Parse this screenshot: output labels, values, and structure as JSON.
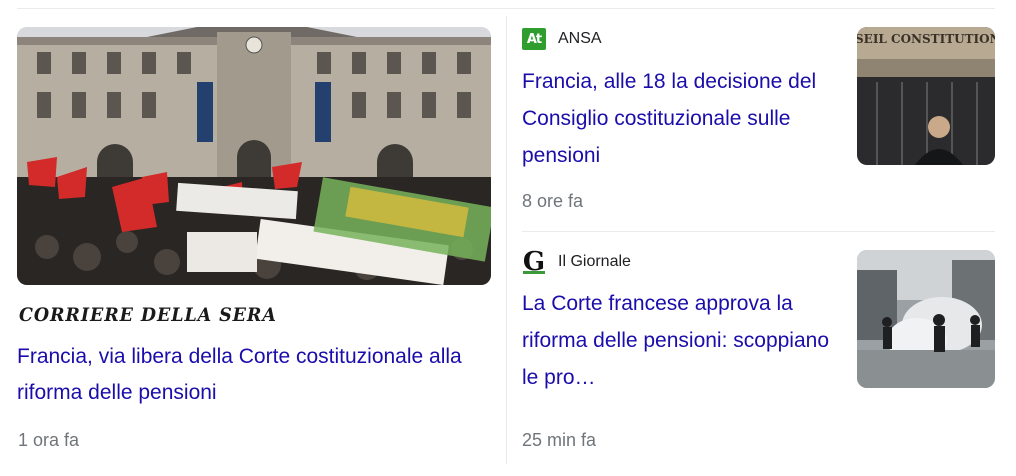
{
  "main_story": {
    "source_logo_text": "CORRIERE DELLA SERA",
    "title": "Francia, via libera della Corte costituzionale alla riforma delle pensioni",
    "time": "1 ora fa"
  },
  "side_stories": [
    {
      "source": "ANSA",
      "icon_text": "At",
      "title": "Francia, alle 18 la decisione del Consiglio costituzionale sulle pensioni",
      "time": "8 ore fa",
      "thumb_text": "SEIL CONSTITUTION"
    },
    {
      "source": "Il Giornale",
      "icon_text": "G",
      "title": "La Corte francese approva la riforma delle pensioni: scoppiano le pro…",
      "time": "25 min fa"
    }
  ],
  "colors": {
    "link": "#1a0dab",
    "meta": "#70757a",
    "ansa_green": "#2f9e2f",
    "giornale_green": "#3a9a3a"
  }
}
